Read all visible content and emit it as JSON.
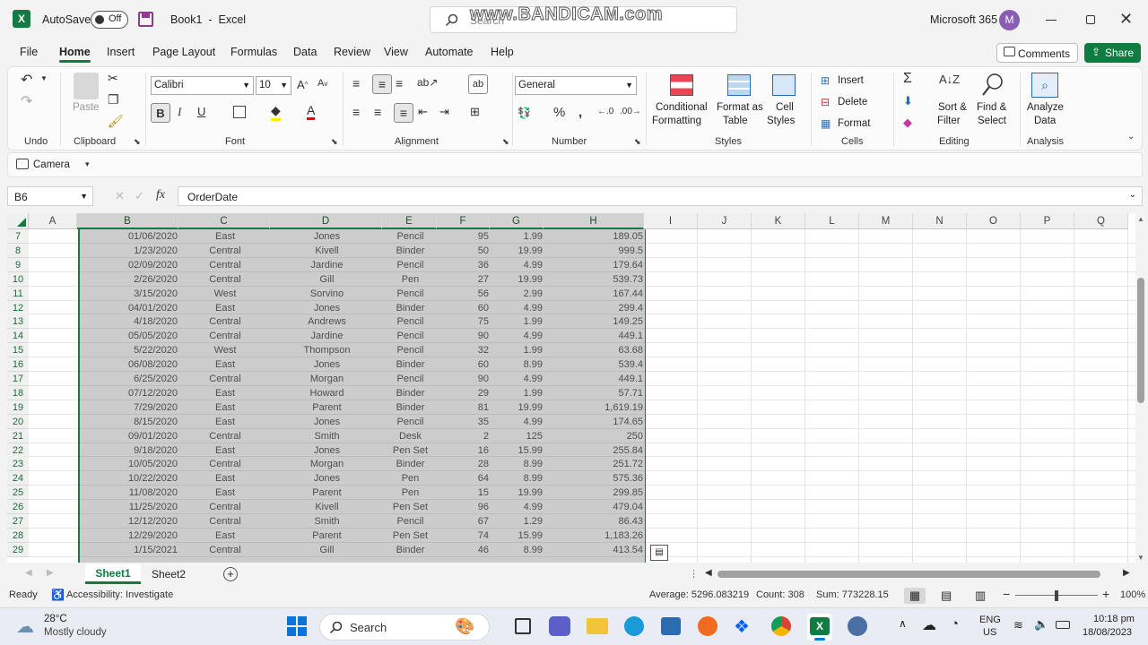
{
  "titlebar": {
    "autosave_label": "AutoSave",
    "autosave_state": "Off",
    "title": "Book1  -  Excel",
    "search_placeholder": "Search",
    "watermark": "www.BANDICAM.com",
    "account": "Microsoft 365",
    "avatar_initial": "M"
  },
  "tabs": [
    "File",
    "Home",
    "Insert",
    "Page Layout",
    "Formulas",
    "Data",
    "Review",
    "View",
    "Automate",
    "Help"
  ],
  "actions": {
    "comments": "Comments",
    "share": "Share"
  },
  "ribbon": {
    "undo_group": "Undo",
    "clipboard_group": "Clipboard",
    "paste": "Paste",
    "font_group": "Font",
    "font_name": "Calibri",
    "font_size": "10",
    "alignment_group": "Alignment",
    "number_group": "Number",
    "number_format": "General",
    "styles_group": "Styles",
    "conditional": "Conditional",
    "formatting": "Formatting",
    "format_as": "Format as",
    "table": "Table",
    "cell": "Cell",
    "styles": "Styles",
    "cells_group": "Cells",
    "insert": "Insert",
    "delete": "Delete",
    "format": "Format",
    "editing_group": "Editing",
    "sort": "Sort &",
    "filter": "Filter",
    "find": "Find &",
    "select": "Select",
    "analysis_group": "Analysis",
    "analyze": "Analyze",
    "data": "Data"
  },
  "qat": {
    "camera": "Camera"
  },
  "formula": {
    "namebox": "B6",
    "content": "OrderDate"
  },
  "columns": [
    "A",
    "B",
    "C",
    "D",
    "E",
    "F",
    "G",
    "H",
    "I",
    "J",
    "K",
    "L",
    "M",
    "N",
    "O",
    "P",
    "Q"
  ],
  "rows": [
    {
      "n": "7",
      "date": "01/06/2020",
      "region": "East",
      "rep": "Jones",
      "item": "Pencil",
      "units": "95",
      "cost": "1.99",
      "total": "189.05"
    },
    {
      "n": "8",
      "date": "1/23/2020",
      "region": "Central",
      "rep": "Kivell",
      "item": "Binder",
      "units": "50",
      "cost": "19.99",
      "total": "999.5"
    },
    {
      "n": "9",
      "date": "02/09/2020",
      "region": "Central",
      "rep": "Jardine",
      "item": "Pencil",
      "units": "36",
      "cost": "4.99",
      "total": "179.64"
    },
    {
      "n": "10",
      "date": "2/26/2020",
      "region": "Central",
      "rep": "Gill",
      "item": "Pen",
      "units": "27",
      "cost": "19.99",
      "total": "539.73"
    },
    {
      "n": "11",
      "date": "3/15/2020",
      "region": "West",
      "rep": "Sorvino",
      "item": "Pencil",
      "units": "56",
      "cost": "2.99",
      "total": "167.44"
    },
    {
      "n": "12",
      "date": "04/01/2020",
      "region": "East",
      "rep": "Jones",
      "item": "Binder",
      "units": "60",
      "cost": "4.99",
      "total": "299.4"
    },
    {
      "n": "13",
      "date": "4/18/2020",
      "region": "Central",
      "rep": "Andrews",
      "item": "Pencil",
      "units": "75",
      "cost": "1.99",
      "total": "149.25"
    },
    {
      "n": "14",
      "date": "05/05/2020",
      "region": "Central",
      "rep": "Jardine",
      "item": "Pencil",
      "units": "90",
      "cost": "4.99",
      "total": "449.1"
    },
    {
      "n": "15",
      "date": "5/22/2020",
      "region": "West",
      "rep": "Thompson",
      "item": "Pencil",
      "units": "32",
      "cost": "1.99",
      "total": "63.68"
    },
    {
      "n": "16",
      "date": "06/08/2020",
      "region": "East",
      "rep": "Jones",
      "item": "Binder",
      "units": "60",
      "cost": "8.99",
      "total": "539.4"
    },
    {
      "n": "17",
      "date": "6/25/2020",
      "region": "Central",
      "rep": "Morgan",
      "item": "Pencil",
      "units": "90",
      "cost": "4.99",
      "total": "449.1"
    },
    {
      "n": "18",
      "date": "07/12/2020",
      "region": "East",
      "rep": "Howard",
      "item": "Binder",
      "units": "29",
      "cost": "1.99",
      "total": "57.71"
    },
    {
      "n": "19",
      "date": "7/29/2020",
      "region": "East",
      "rep": "Parent",
      "item": "Binder",
      "units": "81",
      "cost": "19.99",
      "total": "1,619.19"
    },
    {
      "n": "20",
      "date": "8/15/2020",
      "region": "East",
      "rep": "Jones",
      "item": "Pencil",
      "units": "35",
      "cost": "4.99",
      "total": "174.65"
    },
    {
      "n": "21",
      "date": "09/01/2020",
      "region": "Central",
      "rep": "Smith",
      "item": "Desk",
      "units": "2",
      "cost": "125",
      "total": "250"
    },
    {
      "n": "22",
      "date": "9/18/2020",
      "region": "East",
      "rep": "Jones",
      "item": "Pen Set",
      "units": "16",
      "cost": "15.99",
      "total": "255.84"
    },
    {
      "n": "23",
      "date": "10/05/2020",
      "region": "Central",
      "rep": "Morgan",
      "item": "Binder",
      "units": "28",
      "cost": "8.99",
      "total": "251.72"
    },
    {
      "n": "24",
      "date": "10/22/2020",
      "region": "East",
      "rep": "Jones",
      "item": "Pen",
      "units": "64",
      "cost": "8.99",
      "total": "575.36"
    },
    {
      "n": "25",
      "date": "11/08/2020",
      "region": "East",
      "rep": "Parent",
      "item": "Pen",
      "units": "15",
      "cost": "19.99",
      "total": "299.85"
    },
    {
      "n": "26",
      "date": "11/25/2020",
      "region": "Central",
      "rep": "Kivell",
      "item": "Pen Set",
      "units": "96",
      "cost": "4.99",
      "total": "479.04"
    },
    {
      "n": "27",
      "date": "12/12/2020",
      "region": "Central",
      "rep": "Smith",
      "item": "Pencil",
      "units": "67",
      "cost": "1.29",
      "total": "86.43"
    },
    {
      "n": "28",
      "date": "12/29/2020",
      "region": "East",
      "rep": "Parent",
      "item": "Pen Set",
      "units": "74",
      "cost": "15.99",
      "total": "1,183.26"
    },
    {
      "n": "29",
      "date": "1/15/2021",
      "region": "Central",
      "rep": "Gill",
      "item": "Binder",
      "units": "46",
      "cost": "8.99",
      "total": "413.54"
    }
  ],
  "sheets": [
    "Sheet1",
    "Sheet2"
  ],
  "status": {
    "ready": "Ready",
    "accessibility": "Accessibility: Investigate",
    "average": "Average: 5296.083219",
    "count": "Count: 308",
    "sum": "Sum: 773228.15",
    "zoom": "100%"
  },
  "taskbar": {
    "temp": "28°C",
    "weather": "Mostly cloudy",
    "search": "Search",
    "lang1": "ENG",
    "lang2": "US",
    "time": "10:18 pm",
    "date": "18/08/2023"
  },
  "colors": {
    "accent": "#107c41",
    "selection": "#c6c6c6"
  }
}
